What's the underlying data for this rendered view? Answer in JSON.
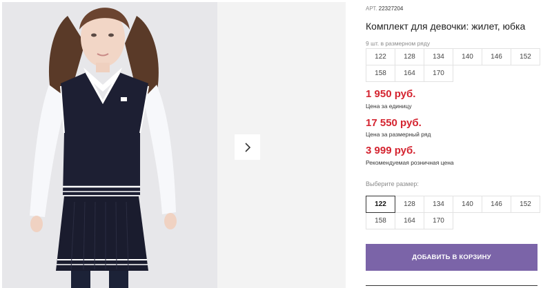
{
  "gallery": {
    "next_icon": "chevron-right-icon"
  },
  "product": {
    "art_prefix": "АРТ.",
    "art_number": "22327204",
    "title": "Комплект для девочки: жилет, юбка",
    "series_note": "9 шт. в размерном ряду",
    "series_sizes": [
      "122",
      "128",
      "134",
      "140",
      "146",
      "152",
      "158",
      "164",
      "170"
    ],
    "prices": [
      {
        "value": "1 950 руб.",
        "label": "Цена за единицу"
      },
      {
        "value": "17 550 руб.",
        "label": "Цена за размерный ряд"
      },
      {
        "value": "3 999 руб.",
        "label": "Рекомендуемая розничная цена"
      }
    ],
    "choose_size_label": "Выберите размер:",
    "size_options": [
      "122",
      "128",
      "134",
      "140",
      "146",
      "152",
      "158",
      "164",
      "170"
    ],
    "selected_size": "122",
    "add_to_cart_label": "ДОБАВИТЬ В КОРЗИНУ"
  },
  "colors": {
    "price": "#d4232f",
    "accent_button": "#7b64a8"
  }
}
